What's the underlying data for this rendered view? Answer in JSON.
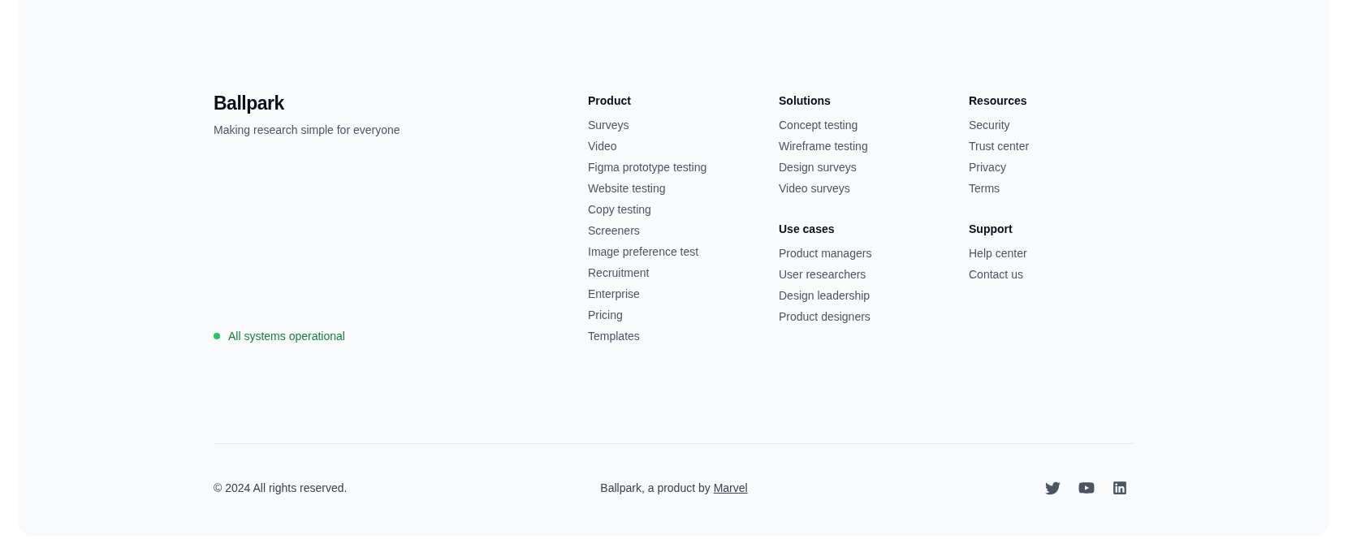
{
  "brand": {
    "logo": "Ballpark",
    "tagline": "Making research simple for everyone"
  },
  "status": {
    "text": "All systems operational",
    "color": "#22c55e"
  },
  "columns": [
    {
      "sections": [
        {
          "heading": "Product",
          "links": [
            "Surveys",
            "Video",
            "Figma prototype testing",
            "Website testing",
            "Copy testing",
            "Screeners",
            "Image preference test",
            "Recruitment",
            "Enterprise",
            "Pricing",
            "Templates"
          ]
        }
      ]
    },
    {
      "sections": [
        {
          "heading": "Solutions",
          "links": [
            "Concept testing",
            "Wireframe testing",
            "Design surveys",
            "Video surveys"
          ]
        },
        {
          "heading": "Use cases",
          "links": [
            "Product managers",
            "User researchers",
            "Design leadership",
            "Product designers"
          ]
        }
      ]
    },
    {
      "sections": [
        {
          "heading": "Resources",
          "links": [
            "Security",
            "Trust center",
            "Privacy",
            "Terms"
          ]
        },
        {
          "heading": "Support",
          "links": [
            "Help center",
            "Contact us"
          ]
        }
      ]
    }
  ],
  "bottom": {
    "copyright": "© 2024 All rights reserved.",
    "credit": {
      "text": "Ballpark, a product by",
      "link": "Marvel"
    },
    "social": [
      {
        "kind": "twitter"
      },
      {
        "kind": "youtube"
      },
      {
        "kind": "linkedin"
      }
    ]
  }
}
